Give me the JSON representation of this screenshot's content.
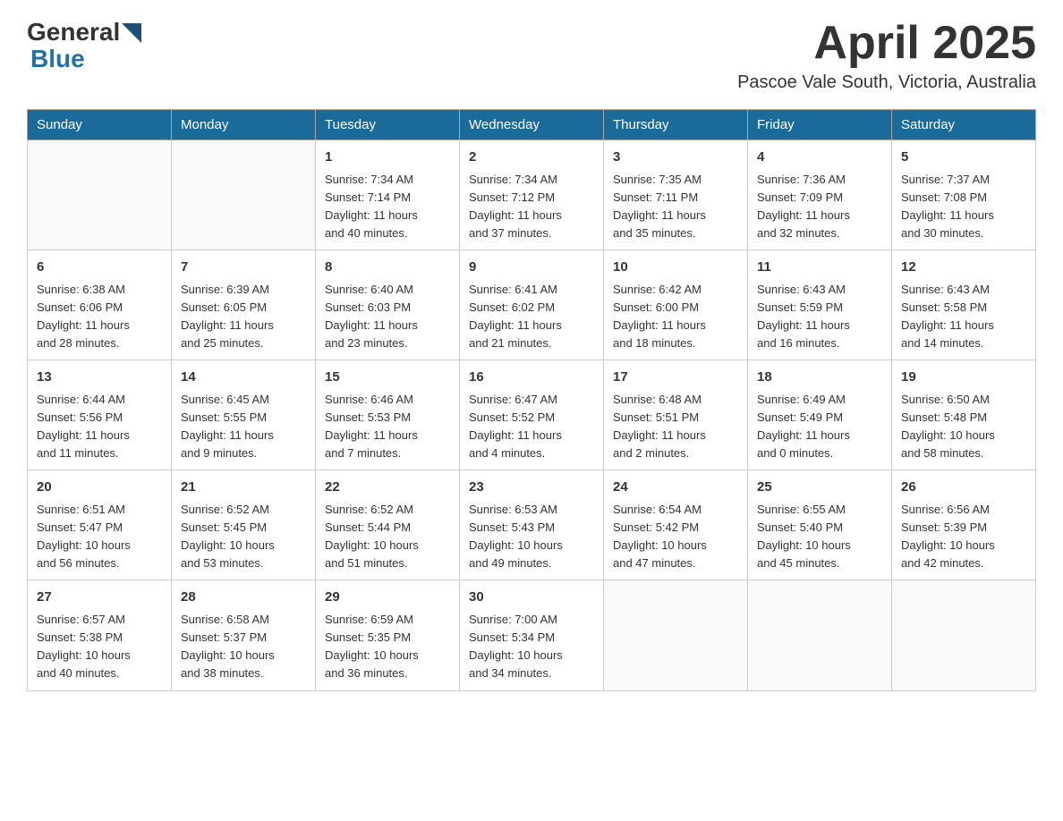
{
  "header": {
    "logo_general": "General",
    "logo_blue": "Blue",
    "title": "April 2025",
    "subtitle": "Pascoe Vale South, Victoria, Australia"
  },
  "days_of_week": [
    "Sunday",
    "Monday",
    "Tuesday",
    "Wednesday",
    "Thursday",
    "Friday",
    "Saturday"
  ],
  "weeks": [
    [
      {
        "day": "",
        "info": ""
      },
      {
        "day": "",
        "info": ""
      },
      {
        "day": "1",
        "info": "Sunrise: 7:34 AM\nSunset: 7:14 PM\nDaylight: 11 hours\nand 40 minutes."
      },
      {
        "day": "2",
        "info": "Sunrise: 7:34 AM\nSunset: 7:12 PM\nDaylight: 11 hours\nand 37 minutes."
      },
      {
        "day": "3",
        "info": "Sunrise: 7:35 AM\nSunset: 7:11 PM\nDaylight: 11 hours\nand 35 minutes."
      },
      {
        "day": "4",
        "info": "Sunrise: 7:36 AM\nSunset: 7:09 PM\nDaylight: 11 hours\nand 32 minutes."
      },
      {
        "day": "5",
        "info": "Sunrise: 7:37 AM\nSunset: 7:08 PM\nDaylight: 11 hours\nand 30 minutes."
      }
    ],
    [
      {
        "day": "6",
        "info": "Sunrise: 6:38 AM\nSunset: 6:06 PM\nDaylight: 11 hours\nand 28 minutes."
      },
      {
        "day": "7",
        "info": "Sunrise: 6:39 AM\nSunset: 6:05 PM\nDaylight: 11 hours\nand 25 minutes."
      },
      {
        "day": "8",
        "info": "Sunrise: 6:40 AM\nSunset: 6:03 PM\nDaylight: 11 hours\nand 23 minutes."
      },
      {
        "day": "9",
        "info": "Sunrise: 6:41 AM\nSunset: 6:02 PM\nDaylight: 11 hours\nand 21 minutes."
      },
      {
        "day": "10",
        "info": "Sunrise: 6:42 AM\nSunset: 6:00 PM\nDaylight: 11 hours\nand 18 minutes."
      },
      {
        "day": "11",
        "info": "Sunrise: 6:43 AM\nSunset: 5:59 PM\nDaylight: 11 hours\nand 16 minutes."
      },
      {
        "day": "12",
        "info": "Sunrise: 6:43 AM\nSunset: 5:58 PM\nDaylight: 11 hours\nand 14 minutes."
      }
    ],
    [
      {
        "day": "13",
        "info": "Sunrise: 6:44 AM\nSunset: 5:56 PM\nDaylight: 11 hours\nand 11 minutes."
      },
      {
        "day": "14",
        "info": "Sunrise: 6:45 AM\nSunset: 5:55 PM\nDaylight: 11 hours\nand 9 minutes."
      },
      {
        "day": "15",
        "info": "Sunrise: 6:46 AM\nSunset: 5:53 PM\nDaylight: 11 hours\nand 7 minutes."
      },
      {
        "day": "16",
        "info": "Sunrise: 6:47 AM\nSunset: 5:52 PM\nDaylight: 11 hours\nand 4 minutes."
      },
      {
        "day": "17",
        "info": "Sunrise: 6:48 AM\nSunset: 5:51 PM\nDaylight: 11 hours\nand 2 minutes."
      },
      {
        "day": "18",
        "info": "Sunrise: 6:49 AM\nSunset: 5:49 PM\nDaylight: 11 hours\nand 0 minutes."
      },
      {
        "day": "19",
        "info": "Sunrise: 6:50 AM\nSunset: 5:48 PM\nDaylight: 10 hours\nand 58 minutes."
      }
    ],
    [
      {
        "day": "20",
        "info": "Sunrise: 6:51 AM\nSunset: 5:47 PM\nDaylight: 10 hours\nand 56 minutes."
      },
      {
        "day": "21",
        "info": "Sunrise: 6:52 AM\nSunset: 5:45 PM\nDaylight: 10 hours\nand 53 minutes."
      },
      {
        "day": "22",
        "info": "Sunrise: 6:52 AM\nSunset: 5:44 PM\nDaylight: 10 hours\nand 51 minutes."
      },
      {
        "day": "23",
        "info": "Sunrise: 6:53 AM\nSunset: 5:43 PM\nDaylight: 10 hours\nand 49 minutes."
      },
      {
        "day": "24",
        "info": "Sunrise: 6:54 AM\nSunset: 5:42 PM\nDaylight: 10 hours\nand 47 minutes."
      },
      {
        "day": "25",
        "info": "Sunrise: 6:55 AM\nSunset: 5:40 PM\nDaylight: 10 hours\nand 45 minutes."
      },
      {
        "day": "26",
        "info": "Sunrise: 6:56 AM\nSunset: 5:39 PM\nDaylight: 10 hours\nand 42 minutes."
      }
    ],
    [
      {
        "day": "27",
        "info": "Sunrise: 6:57 AM\nSunset: 5:38 PM\nDaylight: 10 hours\nand 40 minutes."
      },
      {
        "day": "28",
        "info": "Sunrise: 6:58 AM\nSunset: 5:37 PM\nDaylight: 10 hours\nand 38 minutes."
      },
      {
        "day": "29",
        "info": "Sunrise: 6:59 AM\nSunset: 5:35 PM\nDaylight: 10 hours\nand 36 minutes."
      },
      {
        "day": "30",
        "info": "Sunrise: 7:00 AM\nSunset: 5:34 PM\nDaylight: 10 hours\nand 34 minutes."
      },
      {
        "day": "",
        "info": ""
      },
      {
        "day": "",
        "info": ""
      },
      {
        "day": "",
        "info": ""
      }
    ]
  ]
}
